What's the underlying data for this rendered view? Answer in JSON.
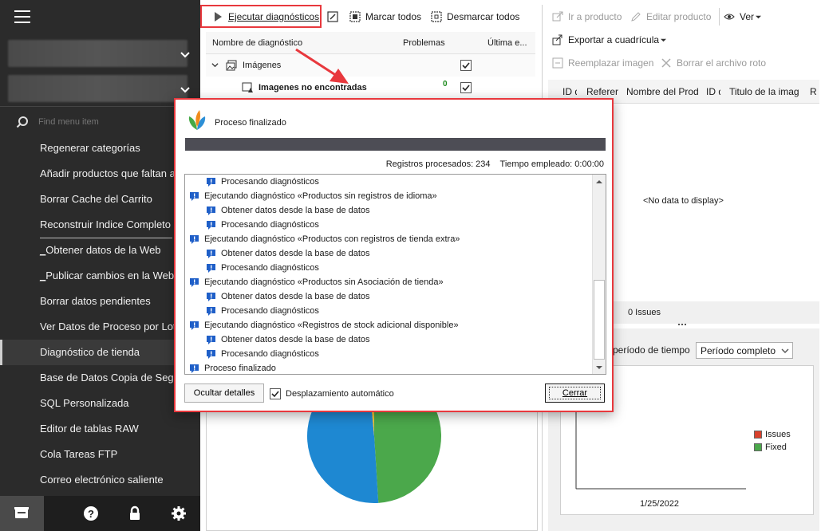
{
  "sidebar": {
    "search_placeholder": "Find menu item",
    "items": [
      {
        "label": "Regenerar categorías"
      },
      {
        "label": "Añadir productos que faltan a"
      },
      {
        "label": "Borrar Cache del Carrito"
      },
      {
        "label": "Reconstruir Indice Completo"
      },
      {
        "label": "Obtener datos de la Web",
        "prefix": "_"
      },
      {
        "label": "Publicar cambios en la Web",
        "prefix": "_"
      },
      {
        "label": "Borrar datos pendientes"
      },
      {
        "label": "Ver Datos de Proceso por Lot"
      },
      {
        "label": "Diagnóstico de tienda"
      },
      {
        "label": "Base de Datos Copia de Segu"
      },
      {
        "label": "SQL Personalizada"
      },
      {
        "label": "Editor de tablas RAW"
      },
      {
        "label": "Cola Tareas FTP"
      },
      {
        "label": "Correo electrónico saliente"
      }
    ],
    "footer_icons": [
      "store-icon",
      "help-icon",
      "lock-icon",
      "gear-icon"
    ]
  },
  "toolbar": {
    "run": "Ejecutar diagnósticos",
    "mark_all": "Marcar todos",
    "unmark_all": "Desmarcar todos",
    "goto_product": "Ir a producto",
    "edit_product": "Editar producto",
    "view": "Ver",
    "export_grid": "Exportar a cuadrícula",
    "replace_image": "Reemplazar imagen",
    "delete_broken": "Borrar el archivo roto"
  },
  "tree": {
    "col_name": "Nombre de diagnóstico",
    "col_problems": "Problemas",
    "col_last": "Última e...",
    "rows": [
      {
        "label": "Imágenes",
        "problems": "",
        "checked": true
      },
      {
        "label": "Imagenes no encontradas",
        "problems": "0",
        "checked": true
      }
    ]
  },
  "grid": {
    "columns": [
      "ID d",
      "Referer",
      "Nombre del Prod",
      "ID d",
      "Titulo de la imag",
      "R"
    ],
    "empty_text": "<No data to display>",
    "issues_count": "0 Issues"
  },
  "period": {
    "label": "período de tiempo",
    "selected": "Período completo"
  },
  "chart": {
    "x_label": "1/25/2022",
    "legend": [
      {
        "name": "Issues",
        "color": "#d9412c"
      },
      {
        "name": "Fixed",
        "color": "#4ba84b"
      }
    ]
  },
  "pie": {
    "colors": [
      "#4ba84b",
      "#1e88d2",
      "#f1c232"
    ]
  },
  "dialog": {
    "title": "Proceso finalizado",
    "records_processed": "Registros procesados: 234",
    "time_spent": "Tiempo empleado: 0:00:00",
    "log": [
      {
        "text": "Procesando diagnósticos",
        "indent": 1
      },
      {
        "text": "Ejecutando diagnóstico «Productos sin registros de idioma»",
        "indent": 0
      },
      {
        "text": "Obtener datos desde la base de datos",
        "indent": 1
      },
      {
        "text": "Procesando diagnósticos",
        "indent": 1
      },
      {
        "text": "Ejecutando diagnóstico «Productos con registros de tienda extra»",
        "indent": 0
      },
      {
        "text": "Obtener datos desde la base de datos",
        "indent": 1
      },
      {
        "text": "Procesando diagnósticos",
        "indent": 1
      },
      {
        "text": "Ejecutando diagnóstico «Productos sin Asociación de tienda»",
        "indent": 0
      },
      {
        "text": "Obtener datos desde la base de datos",
        "indent": 1
      },
      {
        "text": "Procesando diagnósticos",
        "indent": 1
      },
      {
        "text": "Ejecutando diagnóstico «Registros de stock adicional disponible»",
        "indent": 0
      },
      {
        "text": "Obtener datos desde la base de datos",
        "indent": 1
      },
      {
        "text": "Procesando diagnósticos",
        "indent": 1
      },
      {
        "text": "Proceso finalizado",
        "indent": 0
      }
    ],
    "hide_details": "Ocultar detalles",
    "auto_scroll": "Desplazamiento automático",
    "close": "Cerrar"
  },
  "colors": {
    "sidebar_bg": "#2b2b2b",
    "highlight": "#e8383d",
    "progress": "#4d4d55",
    "info_icon": "#1f5fc8"
  }
}
